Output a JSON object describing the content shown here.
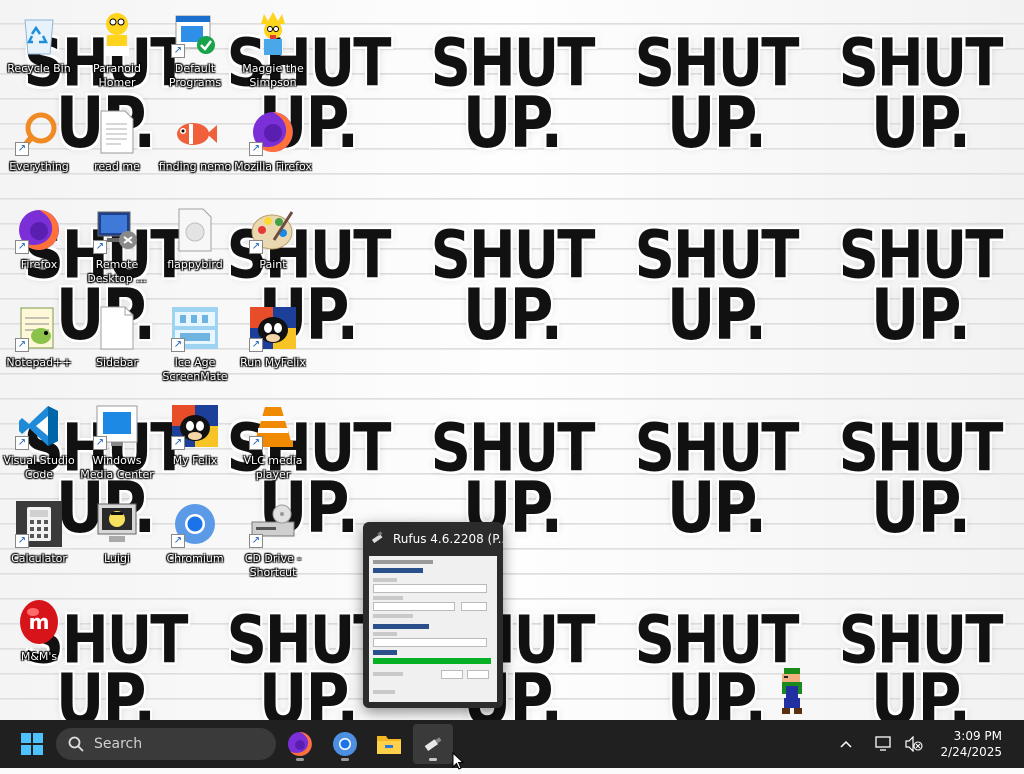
{
  "wallpaper": {
    "text_line1": "SHUT",
    "text_line2": "UP."
  },
  "desktop_icons": [
    {
      "label": "Recycle Bin",
      "icon": "recycle-bin-icon"
    },
    {
      "label": "Paranoid Homer",
      "icon": "homer-icon"
    },
    {
      "label": "Default Programs",
      "icon": "default-programs-icon"
    },
    {
      "label": "Maggie the Simpson",
      "icon": "maggie-icon"
    },
    {
      "label": "Everything",
      "icon": "everything-search-icon"
    },
    {
      "label": "read me",
      "icon": "text-file-icon"
    },
    {
      "label": "finding nemo",
      "icon": "nemo-icon"
    },
    {
      "label": "Mozilla Firefox",
      "icon": "firefox-icon"
    },
    {
      "label": "Firefox",
      "icon": "firefox-icon"
    },
    {
      "label": "Remote Desktop ...",
      "icon": "remote-desktop-icon"
    },
    {
      "label": "flappybird",
      "icon": "file-icon"
    },
    {
      "label": "Paint",
      "icon": "paint-icon"
    },
    {
      "label": "Notepad++",
      "icon": "notepad-plus-icon"
    },
    {
      "label": "Sidebar",
      "icon": "blank-file-icon"
    },
    {
      "label": "Ice Age ScreenMate",
      "icon": "ice-age-icon"
    },
    {
      "label": "Run MyFelix",
      "icon": "felix-icon"
    },
    {
      "label": "Visual Studio Code",
      "icon": "vscode-icon"
    },
    {
      "label": "Windows Media Center",
      "icon": "media-center-icon"
    },
    {
      "label": "My Felix",
      "icon": "felix-icon"
    },
    {
      "label": "VLC media player",
      "icon": "vlc-icon"
    },
    {
      "label": "Calculator",
      "icon": "calculator-icon"
    },
    {
      "label": "Luigi",
      "icon": "luigi-monitor-icon"
    },
    {
      "label": "Chromium",
      "icon": "chromium-icon"
    },
    {
      "label": "CD Drive - Shortcut",
      "icon": "cd-drive-icon"
    },
    {
      "label": "M&M's",
      "icon": "mms-icon"
    }
  ],
  "thumbnail": {
    "title": "Rufus 4.6.2208 (P..."
  },
  "taskbar": {
    "search_placeholder": "Search",
    "apps": [
      "start-icon",
      "firefox-icon",
      "chromium-icon",
      "file-explorer-icon",
      "rufus-icon"
    ],
    "time": "3:09 PM",
    "date": "2/24/2025"
  },
  "colors": {
    "taskbar_bg": "#202020",
    "progress_green": "#06b025",
    "accent": "#0078d4"
  }
}
